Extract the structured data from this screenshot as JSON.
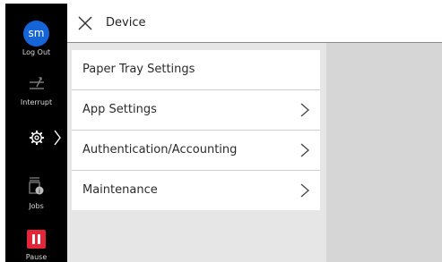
{
  "header": {
    "title": "Device"
  },
  "sidebar": {
    "user_initials": "sm",
    "logout_label": "Log Out",
    "interrupt_label": "Interrupt",
    "jobs_label": "Jobs",
    "pause_label": "Pause"
  },
  "menu": {
    "items": [
      {
        "label": "Paper Tray Settings",
        "has_chevron": false
      },
      {
        "label": "App Settings",
        "has_chevron": true
      },
      {
        "label": "Authentication/Accounting",
        "has_chevron": true
      },
      {
        "label": "Maintenance",
        "has_chevron": true
      }
    ]
  },
  "colors": {
    "avatar": "#1565d8",
    "pause": "#e3263a",
    "sidebar": "#000000",
    "content_bg": "#d6d6d6"
  },
  "icons": {
    "close": "close-icon",
    "logout": "avatar",
    "interrupt": "interrupt-icon",
    "settings": "gear-icon",
    "jobs": "jobs-icon",
    "pause": "pause-icon"
  }
}
